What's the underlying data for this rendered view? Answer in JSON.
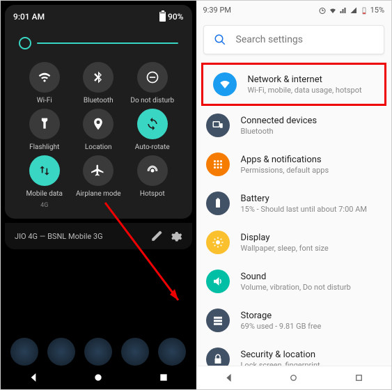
{
  "left": {
    "time": "9:01 AM",
    "battery": "90%",
    "tiles": [
      {
        "label": "Wi-Fi",
        "sub": ""
      },
      {
        "label": "Bluetooth",
        "sub": ""
      },
      {
        "label": "Do not disturb",
        "sub": ""
      },
      {
        "label": "Flashlight",
        "sub": ""
      },
      {
        "label": "Location",
        "sub": ""
      },
      {
        "label": "Auto-rotate",
        "sub": ""
      },
      {
        "label": "Mobile data",
        "sub": "4G"
      },
      {
        "label": "Airplane mode",
        "sub": ""
      },
      {
        "label": "Hotspot",
        "sub": ""
      }
    ],
    "footer": "JIO 4G — BSNL Mobile 3G"
  },
  "right": {
    "time": "9:39 PM",
    "battery": "15%",
    "search": "Search settings",
    "items": [
      {
        "title": "Network & internet",
        "sub": "Wi-Fi, mobile, data usage, hotspot",
        "color": "#1a9cf0"
      },
      {
        "title": "Connected devices",
        "sub": "Bluetooth",
        "color": "#3a4a5a"
      },
      {
        "title": "Apps & notifications",
        "sub": "Permissions, default apps",
        "color": "#f57c00"
      },
      {
        "title": "Battery",
        "sub": "15% - Should last until about 7:00 AM",
        "color": "#3a4a5a"
      },
      {
        "title": "Display",
        "sub": "Wallpaper, sleep, font size",
        "color": "#fbc02d"
      },
      {
        "title": "Sound",
        "sub": "Volume, vibration, Do not disturb",
        "color": "#00bfa5"
      },
      {
        "title": "Storage",
        "sub": "69% used - 9.81 GB free",
        "color": "#3a4a5a"
      },
      {
        "title": "Security & location",
        "sub": "Lock screen, fingerprint",
        "color": "#3a4a5a"
      }
    ]
  }
}
